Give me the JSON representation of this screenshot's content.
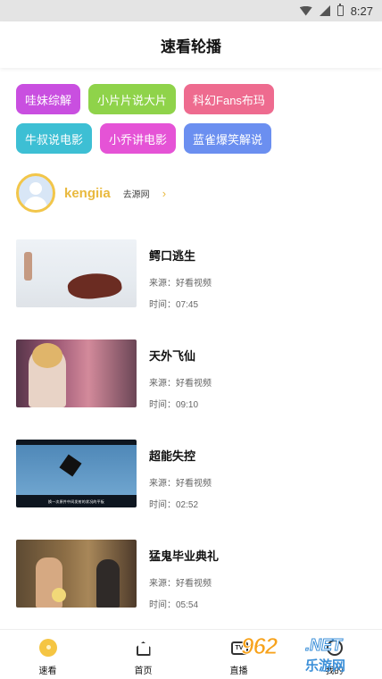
{
  "status_bar": {
    "time": "8:27"
  },
  "header": {
    "title": "速看轮播"
  },
  "tags": [
    {
      "label": "哇妹综解",
      "color": "#c94fe0"
    },
    {
      "label": "小片片说大片",
      "color": "#8fd34a"
    },
    {
      "label": "科幻Fans布玛",
      "color": "#ee6b8f"
    },
    {
      "label": "牛叔说电影",
      "color": "#3dbfd4"
    },
    {
      "label": "小乔讲电影",
      "color": "#e553d6"
    },
    {
      "label": "蓝雀爆笑解说",
      "color": "#6b8ff0"
    }
  ],
  "author": {
    "name": "kengiia",
    "link_label": "去源网",
    "arrow": "›"
  },
  "videos": [
    {
      "title": "鳄口逃生",
      "source": "来源：好看视频",
      "time": "时间：07:45"
    },
    {
      "title": "天外飞仙",
      "source": "来源：好看视频",
      "time": "时间：09:10"
    },
    {
      "title": "超能失控",
      "source": "来源：好看视频",
      "time": "时间：02:52",
      "subtitle": "换一次原件中间发射的状况的平板"
    },
    {
      "title": "猛鬼毕业典礼",
      "source": "来源：好看视频",
      "time": "时间：05:54"
    }
  ],
  "bottom_nav": [
    {
      "label": "速看",
      "icon": "speed-icon",
      "active": true
    },
    {
      "label": "首页",
      "icon": "home-icon"
    },
    {
      "label": "直播",
      "icon": "tv-icon"
    },
    {
      "label": "我的",
      "icon": "user-icon"
    }
  ],
  "watermark": {
    "number": "962",
    "suffix": ".NET",
    "cn": "乐游网"
  }
}
